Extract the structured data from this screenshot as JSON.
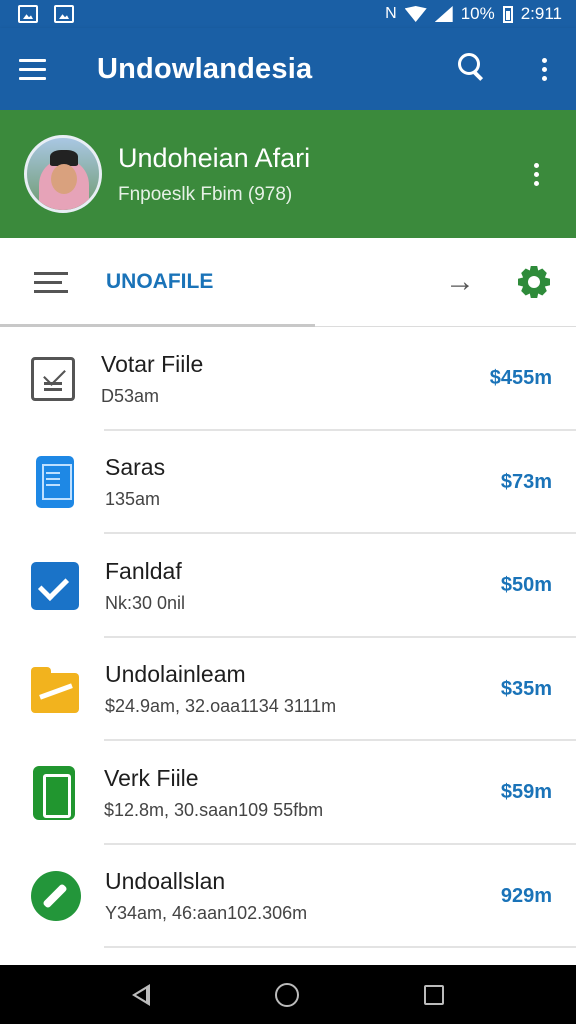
{
  "status_bar": {
    "battery": "10%",
    "time": "2:911",
    "nfc_glyph": "N"
  },
  "app_bar": {
    "title": "Undowlandesia"
  },
  "profile": {
    "name": "Undoheian Afari",
    "subtitle": "Fnpoeslk Fbim (978)"
  },
  "toolbar": {
    "label": "UNOAFILE",
    "arrow_glyph": "→"
  },
  "rows": [
    {
      "icon": "mail-icon",
      "title": "Votar Fiile",
      "subtitle": "D53am",
      "value": "$455m"
    },
    {
      "icon": "tablet-icon",
      "title": "Saras",
      "subtitle": "135am",
      "value": "$73m"
    },
    {
      "icon": "checkbox-icon",
      "title": "Fanldaf",
      "subtitle": "Nk:30 0nil",
      "value": "$50m"
    },
    {
      "icon": "folder-icon",
      "title": "Undolainleam",
      "subtitle": "$24.9am, 32.oaa1134 3111m",
      "value": "$35m"
    },
    {
      "icon": "phone-icon",
      "title": "Verk Fiile",
      "subtitle": "$12.8m, 30.saan109 55fbm",
      "value": "$59m"
    },
    {
      "icon": "pen-icon",
      "title": "Undoallslan",
      "subtitle": "Y34am, 46:aan102.306m",
      "value": "929m"
    }
  ],
  "colors": {
    "app_bar": "#1a5fa5",
    "profile_bg": "#3b8a3c",
    "accent_blue": "#1a73b8",
    "accent_green": "#2e8b3a"
  }
}
